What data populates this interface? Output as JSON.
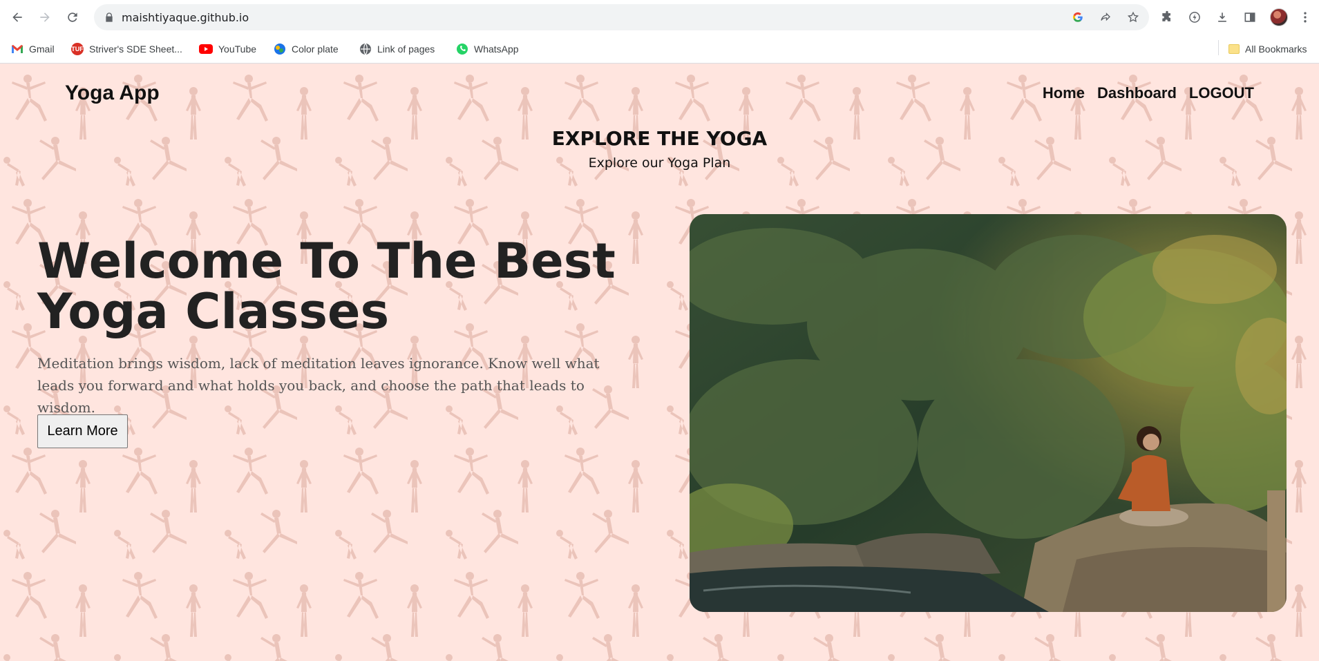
{
  "browser": {
    "url": "maishtiyaque.github.io",
    "bookmarks": [
      {
        "label": "Gmail",
        "icon": "gmail-icon",
        "color": "#ea4335"
      },
      {
        "label": "Striver's SDE Sheet...",
        "icon": "tuf-icon",
        "color": "#d93025"
      },
      {
        "label": "YouTube",
        "icon": "youtube-icon",
        "color": "#ff0000"
      },
      {
        "label": "Color plate",
        "icon": "color-plate-icon",
        "color": "#1a73e8"
      },
      {
        "label": "Link of pages",
        "icon": "globe-icon",
        "color": "#5f6368"
      },
      {
        "label": "WhatsApp",
        "icon": "whatsapp-icon",
        "color": "#25d366"
      }
    ],
    "all_bookmarks": "All Bookmarks"
  },
  "site": {
    "brand": "Yoga App",
    "nav": {
      "home": "Home",
      "dashboard": "Dashboard",
      "logout": "LOGOUT"
    },
    "explore_title": "EXPLORE THE YOGA",
    "explore_subtitle": "Explore our Yoga Plan",
    "hero": {
      "title": "Welcome To The Best Yoga Classes",
      "text": "Meditation brings wisdom, lack of meditation leaves ignorance. Know well what leads you forward and what holds you back, and choose the path that leads to wisdom.",
      "button": "Learn More"
    },
    "colors": {
      "background": "#ffe5df",
      "pattern": "#e8bfb5"
    }
  }
}
